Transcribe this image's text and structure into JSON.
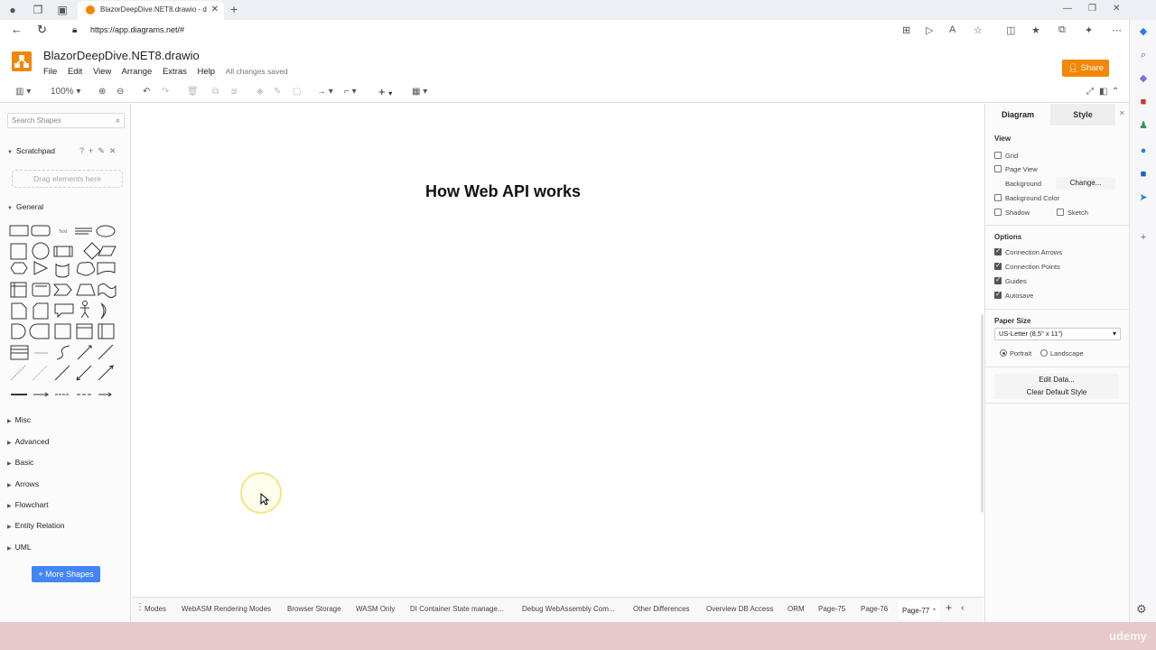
{
  "browser": {
    "tab_title": "BlazorDeepDive.NET8.drawio - d",
    "url": "https://app.diagrams.net/#"
  },
  "app": {
    "filename": "BlazorDeepDive.NET8.drawio",
    "menu": [
      "File",
      "Edit",
      "View",
      "Arrange",
      "Extras",
      "Help"
    ],
    "save_status": "All changes saved",
    "share_label": "Share",
    "zoom": "100%"
  },
  "left_panel": {
    "search_placeholder": "Search Shapes",
    "scratchpad": "Scratchpad",
    "drag_hint": "Drag elements here",
    "general": "General",
    "libraries": [
      "Misc",
      "Advanced",
      "Basic",
      "Arrows",
      "Flowchart",
      "Entity Relation",
      "UML"
    ],
    "more_shapes": "+ More Shapes"
  },
  "canvas": {
    "title": "How Web API works"
  },
  "right_panel": {
    "tab_diagram": "Diagram",
    "tab_style": "Style",
    "view_heading": "View",
    "grid": "Grid",
    "page_view": "Page View",
    "background": "Background",
    "change": "Change...",
    "background_color": "Background Color",
    "shadow": "Shadow",
    "sketch": "Sketch",
    "options_heading": "Options",
    "connection_arrows": "Connection Arrows",
    "connection_points": "Connection Points",
    "guides": "Guides",
    "autosave": "Autosave",
    "paper_size_heading": "Paper Size",
    "paper_size_value": "US-Letter (8,5\" x 11\")",
    "portrait": "Portrait",
    "landscape": "Landscape",
    "edit_data": "Edit Data...",
    "clear_default_style": "Clear Default Style"
  },
  "pages": [
    "Modes",
    "WebASM Rendering Modes",
    "Browser Storage",
    "WASM Only",
    "DI Container State manage...",
    "Debug WebAssembly Com...",
    "Other Differences",
    "Overview DB Access",
    "ORM",
    "Page-75",
    "Page-76",
    "Page-77"
  ],
  "watermark": "udemy"
}
